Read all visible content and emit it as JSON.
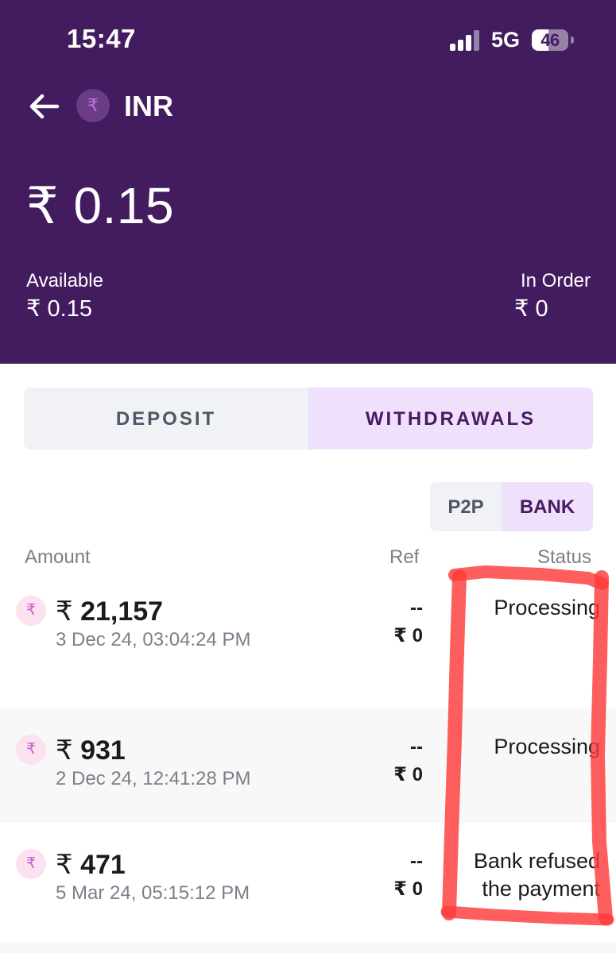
{
  "status_bar": {
    "time": "15:47",
    "network": "5G",
    "battery": "46",
    "battery_percent": 46
  },
  "header": {
    "currency_symbol": "₹",
    "currency_code": "INR",
    "total_balance": "₹ 0.15",
    "available_label": "Available",
    "available_value": "₹ 0.15",
    "in_order_label": "In Order",
    "in_order_value": "₹ 0"
  },
  "tabs": {
    "deposit": "DEPOSIT",
    "withdrawals": "WITHDRAWALS",
    "active": "withdrawals"
  },
  "method_toggle": {
    "p2p": "P2P",
    "bank": "BANK",
    "active": "bank"
  },
  "table": {
    "columns": {
      "amount": "Amount",
      "ref": "Ref",
      "status": "Status"
    },
    "rows": [
      {
        "symbol": "₹",
        "amount": "21,157",
        "date": "3 Dec 24, 03:04:24 PM",
        "ref": "--",
        "ref_amount": "₹ 0",
        "status": "Processing"
      },
      {
        "symbol": "₹",
        "amount": "931",
        "date": "2 Dec 24, 12:41:28 PM",
        "ref": "--",
        "ref_amount": "₹ 0",
        "status": "Processing"
      },
      {
        "symbol": "₹",
        "amount": "471",
        "date": "5 Mar 24, 05:15:12 PM",
        "ref": "--",
        "ref_amount": "₹ 0",
        "status": "Bank refused the payment"
      }
    ]
  },
  "colors": {
    "header_bg": "#431b5f",
    "active_tab_bg": "#efe0fb",
    "active_tab_text": "#4a1a64",
    "annotation": "#ff3b3b"
  },
  "icons": {
    "back": "arrow-left-icon",
    "currency": "rupee-coin-icon",
    "signal": "signal-bars-icon",
    "battery": "battery-icon"
  }
}
